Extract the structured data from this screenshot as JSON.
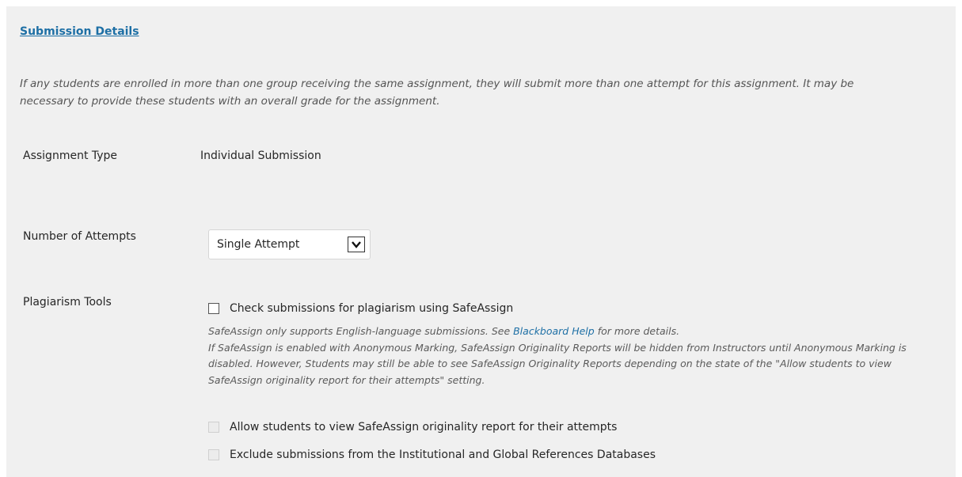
{
  "section": {
    "title": "Submission Details",
    "intro": "If any students are enrolled in more than one group receiving the same assignment, they will submit more than one attempt for this assignment. It may be necessary to provide these students with an overall grade for the assignment."
  },
  "assignment_type": {
    "label": "Assignment Type",
    "value": "Individual Submission"
  },
  "attempts": {
    "label": "Number of Attempts",
    "selected": "Single Attempt",
    "arrow_icon": "chevron-down-icon"
  },
  "plagiarism": {
    "label": "Plagiarism Tools",
    "check_label": "Check submissions for plagiarism using SafeAssign",
    "checked": false,
    "help_before_link": "SafeAssign only supports English-language submissions. See ",
    "help_link": "Blackboard Help",
    "help_after_link": " for more details.",
    "help_line2": "If SafeAssign is enabled with Anonymous Marking, SafeAssign Originality Reports will be hidden from Instructors until Anonymous Marking is disabled. However, Students may still be able to see SafeAssign Originality Reports depending on the state of the \"Allow students to view SafeAssign originality report for their attempts\" setting.",
    "allow_view_label": "Allow students to view SafeAssign originality report for their attempts",
    "exclude_label": "Exclude submissions from the Institutional and Global References Databases"
  },
  "colors": {
    "link": "#1d6fa5",
    "panel_bg": "#f0f0f0"
  }
}
